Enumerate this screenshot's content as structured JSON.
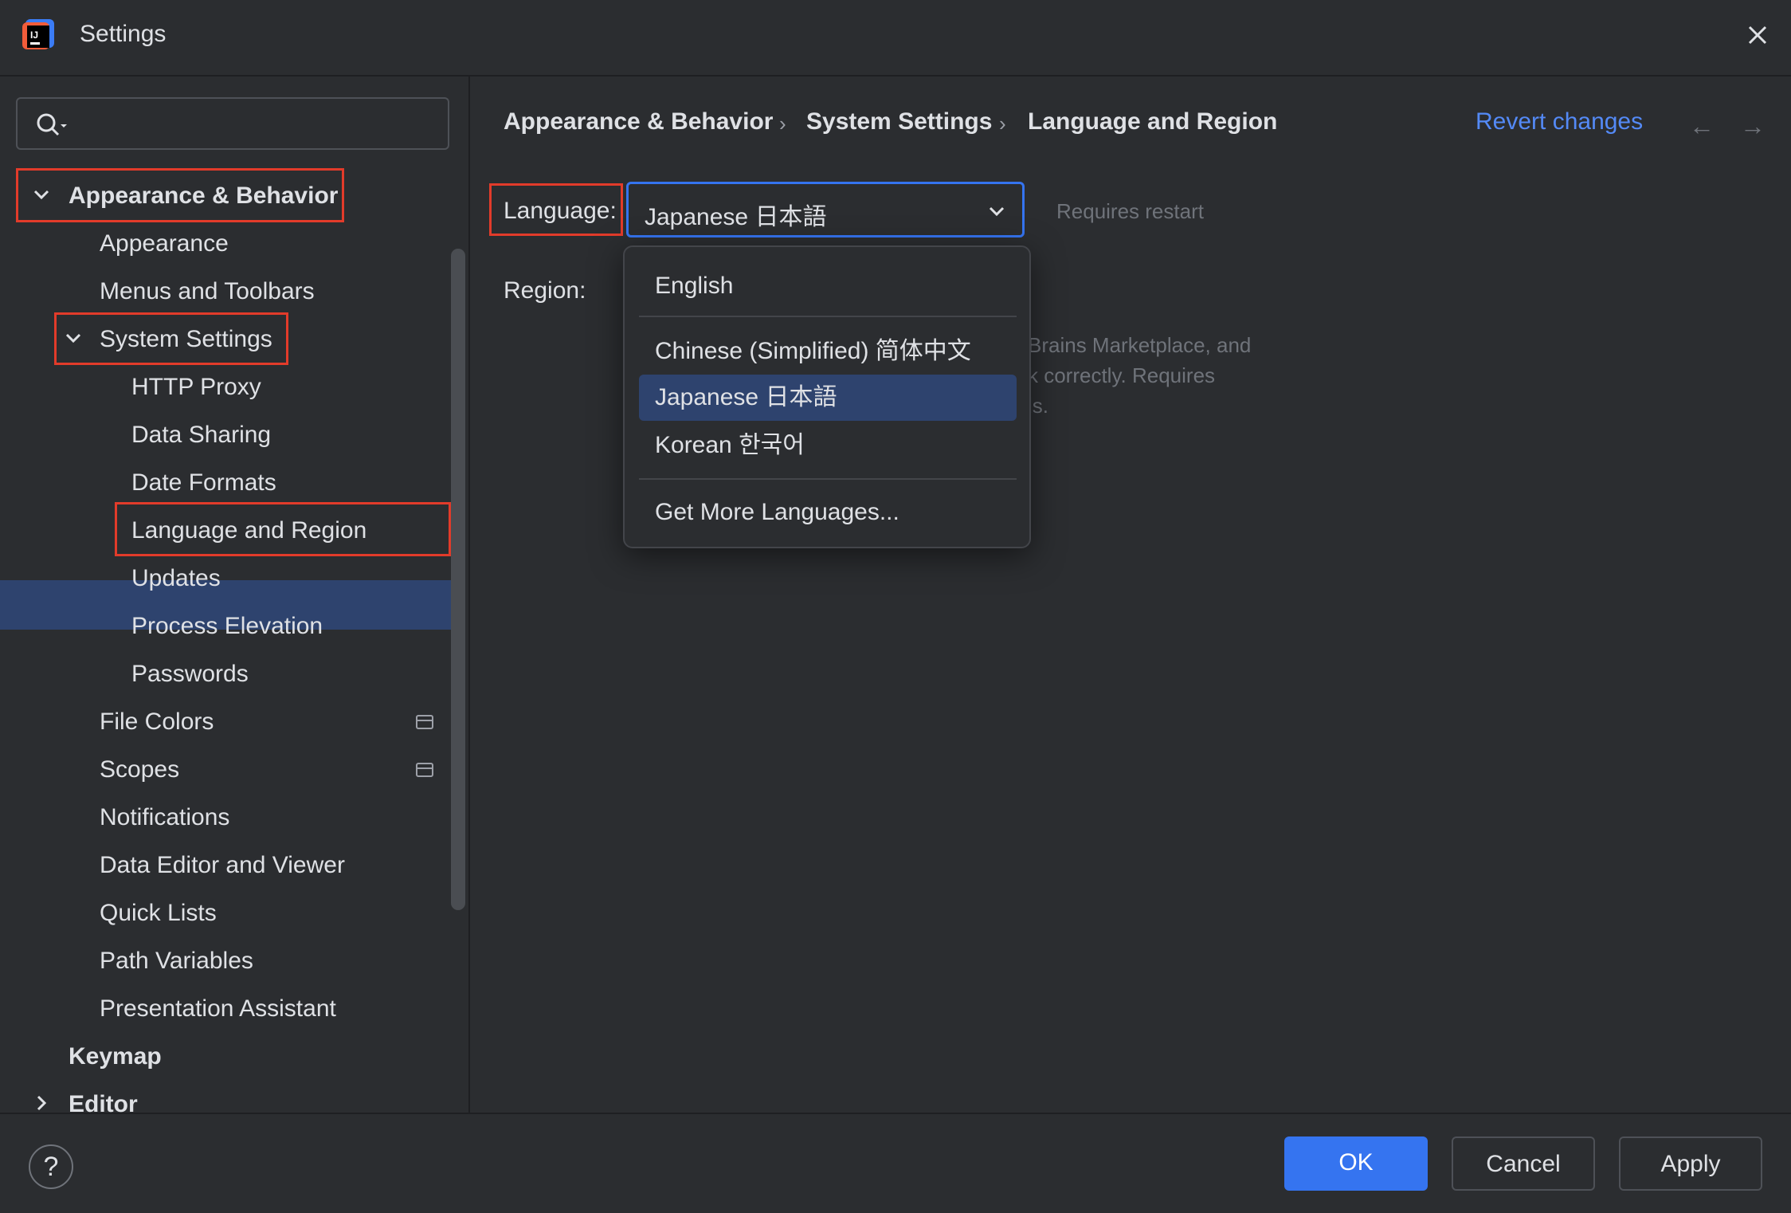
{
  "window": {
    "title": "Settings"
  },
  "search": {
    "placeholder": ""
  },
  "tree": {
    "appearance_behavior": "Appearance & Behavior",
    "appearance": "Appearance",
    "menus_toolbars": "Menus and Toolbars",
    "system_settings": "System Settings",
    "http_proxy": "HTTP Proxy",
    "data_sharing": "Data Sharing",
    "date_formats": "Date Formats",
    "language_region": "Language and Region",
    "updates": "Updates",
    "process_elevation": "Process Elevation",
    "passwords": "Passwords",
    "file_colors": "File Colors",
    "scopes": "Scopes",
    "notifications": "Notifications",
    "data_editor": "Data Editor and Viewer",
    "quick_lists": "Quick Lists",
    "path_variables": "Path Variables",
    "presentation_assistant": "Presentation Assistant",
    "keymap": "Keymap",
    "editor": "Editor"
  },
  "breadcrumb": [
    "Appearance & Behavior",
    "System Settings",
    "Language and Region"
  ],
  "revert_label": "Revert changes",
  "form": {
    "language_label": "Language:",
    "language_value": "Japanese 日本語",
    "requires_restart": "Requires restart",
    "region_label": "Region:",
    "desc_line1": "Brains Marketplace, and",
    "desc_line2": "k correctly. Requires",
    "desc_line3": "ls."
  },
  "dropdown": {
    "options": [
      "English",
      "Chinese (Simplified) 简体中文",
      "Japanese 日本語",
      "Korean 한국어",
      "Get More Languages..."
    ],
    "selected": "Japanese 日本語"
  },
  "footer": {
    "help": "?",
    "ok": "OK",
    "cancel": "Cancel",
    "apply": "Apply"
  },
  "colors": {
    "accent": "#3574f0",
    "selection": "#2e436e",
    "highlight_box": "#e23b2a",
    "link": "#548af7",
    "background": "#2b2d30"
  }
}
